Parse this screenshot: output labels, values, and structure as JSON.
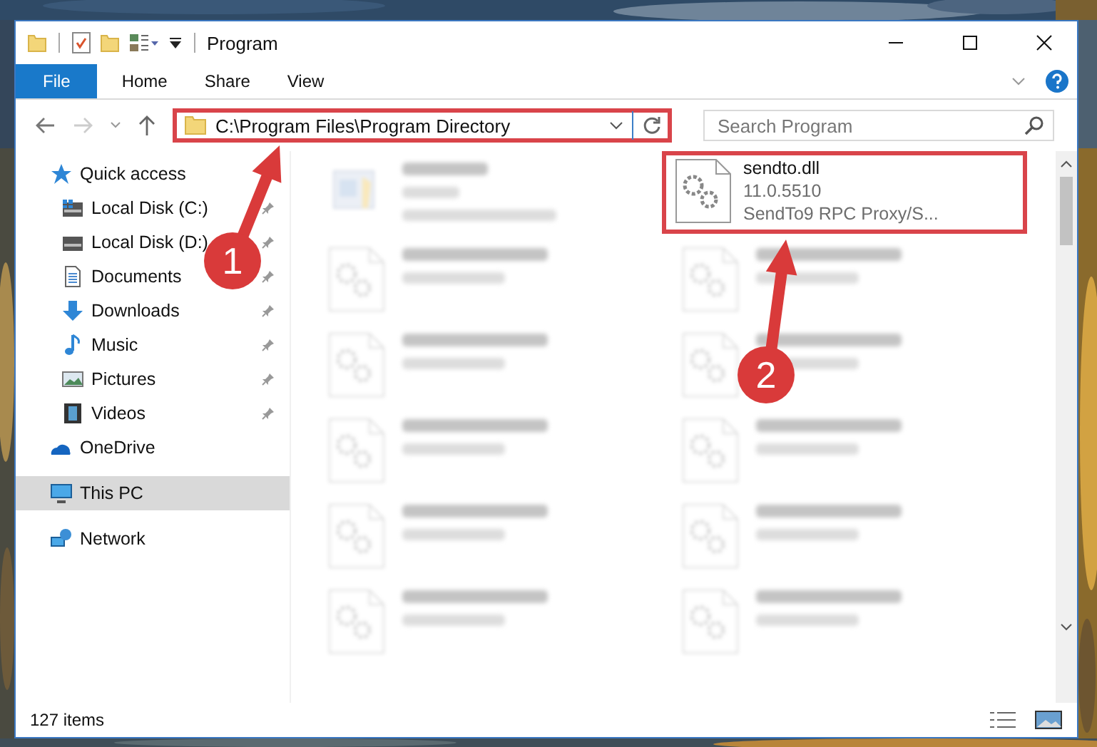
{
  "window": {
    "title": "Program"
  },
  "ribbon": {
    "tabs": [
      {
        "label": "File",
        "kind": "file",
        "selected": false
      },
      {
        "label": "Home",
        "kind": "tab",
        "selected": false
      },
      {
        "label": "Share",
        "kind": "tab",
        "selected": false
      },
      {
        "label": "View",
        "kind": "tab",
        "selected": false
      }
    ]
  },
  "address": {
    "path": "C:\\Program Files\\Program Directory",
    "highlighted": true
  },
  "search": {
    "placeholder": "Search Program"
  },
  "sidebar": {
    "items": [
      {
        "label": "Quick access",
        "kind": "star",
        "selected": false,
        "children": [
          {
            "label": "Local Disk (C:)",
            "kind": "drive-windows",
            "pinned": true,
            "selected": false
          },
          {
            "label": "Local Disk (D:)",
            "kind": "drive",
            "pinned": true,
            "selected": false
          },
          {
            "label": "Documents",
            "kind": "documents",
            "pinned": true,
            "selected": false
          },
          {
            "label": "Downloads",
            "kind": "downloads",
            "pinned": true,
            "selected": false
          },
          {
            "label": "Music",
            "kind": "music",
            "pinned": true,
            "selected": false
          },
          {
            "label": "Pictures",
            "kind": "pictures",
            "pinned": true,
            "selected": false
          },
          {
            "label": "Videos",
            "kind": "videos",
            "pinned": true,
            "selected": false
          }
        ]
      },
      {
        "label": "OneDrive",
        "kind": "cloud",
        "selected": false
      },
      {
        "label": "This PC",
        "kind": "pc",
        "selected": true
      },
      {
        "label": "Network",
        "kind": "network",
        "selected": false
      }
    ]
  },
  "files": [
    {
      "kind": "exe",
      "faded": true,
      "highlighted": false
    },
    {
      "name": "sendto.dll",
      "kind": "dll",
      "faded": false,
      "highlighted": true,
      "details": [
        "11.0.5510",
        "SendTo9 RPC Proxy/S..."
      ]
    },
    {
      "kind": "dll",
      "faded": true,
      "highlighted": false
    },
    {
      "kind": "dll",
      "faded": true,
      "highlighted": false
    },
    {
      "kind": "dll",
      "faded": true,
      "highlighted": false
    },
    {
      "kind": "dll",
      "faded": true,
      "highlighted": false
    },
    {
      "kind": "dll",
      "faded": true,
      "highlighted": false
    },
    {
      "kind": "dll",
      "faded": true,
      "highlighted": false
    },
    {
      "kind": "dll",
      "faded": true,
      "highlighted": false
    },
    {
      "kind": "dll",
      "faded": true,
      "highlighted": false
    },
    {
      "kind": "dll",
      "faded": true,
      "highlighted": false
    },
    {
      "kind": "dll",
      "faded": true,
      "highlighted": false
    }
  ],
  "annotations": [
    {
      "label": "1"
    },
    {
      "label": "2"
    }
  ],
  "status_bar": {
    "count": "127 items"
  }
}
